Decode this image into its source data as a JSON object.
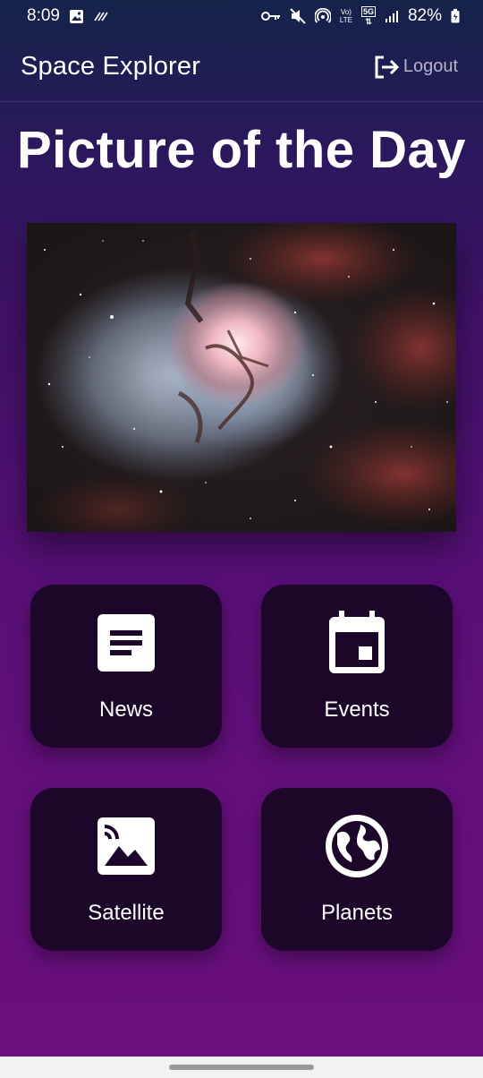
{
  "status_bar": {
    "time": "8:09",
    "network_label_top": "Vo)",
    "network_label_bottom": "LTE",
    "network_gen": "5G",
    "battery": "82%"
  },
  "app_bar": {
    "title": "Space Explorer",
    "logout_label": "Logout"
  },
  "main": {
    "title": "Picture of the Day"
  },
  "tiles": [
    {
      "label": "News",
      "icon": "article-icon"
    },
    {
      "label": "Events",
      "icon": "calendar-icon"
    },
    {
      "label": "Satellite",
      "icon": "satellite-image-icon"
    },
    {
      "label": "Planets",
      "icon": "globe-icon"
    }
  ],
  "colors": {
    "tile_background": "#1c0629",
    "background_top": "#14234a",
    "background_bottom": "#6a0f7e",
    "logout_text": "#b9b2c9"
  }
}
